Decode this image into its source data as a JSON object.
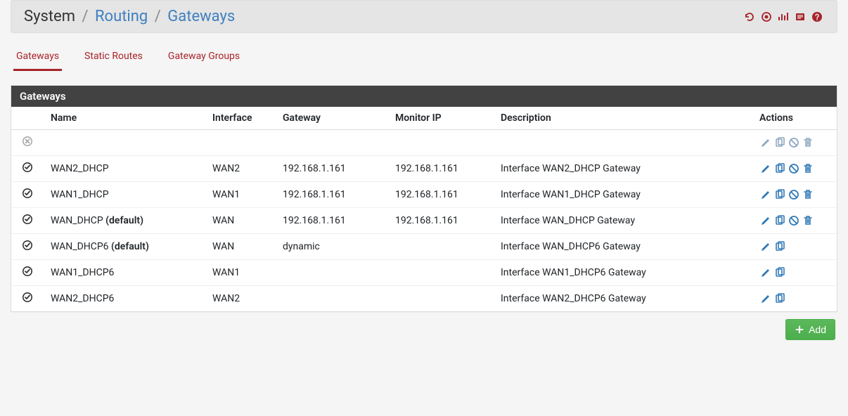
{
  "breadcrumb": {
    "system": "System",
    "routing": "Routing",
    "gateways": "Gateways"
  },
  "tabs": {
    "gateways": "Gateways",
    "static_routes": "Static Routes",
    "gateway_groups": "Gateway Groups"
  },
  "panel": {
    "title": "Gateways"
  },
  "columns": {
    "name": "Name",
    "interface": "Interface",
    "gateway": "Gateway",
    "monitor": "Monitor IP",
    "description": "Description",
    "actions": "Actions"
  },
  "rows": [
    {
      "status": "disabled",
      "name": "",
      "name_suffix": "",
      "interface": "",
      "gateway": "",
      "monitor": "",
      "description": "",
      "actions": [
        "edit",
        "copy",
        "disable",
        "delete"
      ],
      "muted": true
    },
    {
      "status": "ok",
      "name": "WAN2_DHCP",
      "name_suffix": "",
      "interface": "WAN2",
      "gateway": "192.168.1.161",
      "monitor": "192.168.1.161",
      "description": "Interface WAN2_DHCP Gateway",
      "actions": [
        "edit",
        "copy",
        "disable",
        "delete"
      ],
      "muted": false
    },
    {
      "status": "ok",
      "name": "WAN1_DHCP",
      "name_suffix": "",
      "interface": "WAN1",
      "gateway": "192.168.1.161",
      "monitor": "192.168.1.161",
      "description": "Interface WAN1_DHCP Gateway",
      "actions": [
        "edit",
        "copy",
        "disable",
        "delete"
      ],
      "muted": false
    },
    {
      "status": "ok",
      "name": "WAN_DHCP ",
      "name_suffix": "(default)",
      "interface": "WAN",
      "gateway": "192.168.1.161",
      "monitor": "192.168.1.161",
      "description": "Interface WAN_DHCP Gateway",
      "actions": [
        "edit",
        "copy",
        "disable",
        "delete"
      ],
      "muted": false
    },
    {
      "status": "ok",
      "name": "WAN_DHCP6 ",
      "name_suffix": "(default)",
      "interface": "WAN",
      "gateway": "dynamic",
      "monitor": "",
      "description": "Interface WAN_DHCP6 Gateway",
      "actions": [
        "edit",
        "copy"
      ],
      "muted": false
    },
    {
      "status": "ok",
      "name": "WAN1_DHCP6",
      "name_suffix": "",
      "interface": "WAN1",
      "gateway": "",
      "monitor": "",
      "description": "Interface WAN1_DHCP6 Gateway",
      "actions": [
        "edit",
        "copy"
      ],
      "muted": false
    },
    {
      "status": "ok",
      "name": "WAN2_DHCP6",
      "name_suffix": "",
      "interface": "WAN2",
      "gateway": "",
      "monitor": "",
      "description": "Interface WAN2_DHCP6 Gateway",
      "actions": [
        "edit",
        "copy"
      ],
      "muted": false
    }
  ],
  "buttons": {
    "add": "Add"
  },
  "icons": {
    "edit": "pencil-icon",
    "copy": "copy-icon",
    "disable": "ban-icon",
    "delete": "trash-icon"
  },
  "colors": {
    "accent_red": "#a9232a",
    "action_blue": "#337ab7",
    "action_muted": "#8fa8c2",
    "add_green": "#5cb85c"
  }
}
